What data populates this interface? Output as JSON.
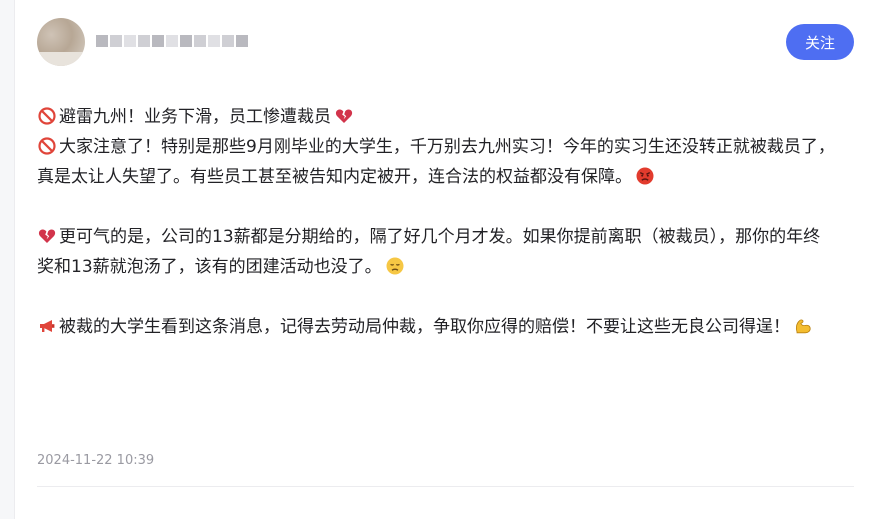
{
  "author": {
    "name": "██████████"
  },
  "follow_button": {
    "label": "关注"
  },
  "post": {
    "line1": "避雷九州！业务下滑，员工惨遭裁员",
    "para1": "大家注意了！特别是那些9月刚毕业的大学生，千万别去九州实习！今年的实习生还没转正就被裁员了，真是太让人失望了。有些员工甚至被告知内定被开，连合法的权益都没有保障。",
    "para2": "更可气的是，公司的13薪都是分期给的，隔了好几个月才发。如果你提前离职（被裁员），那你的年终奖和13薪就泡汤了，该有的团建活动也没了。",
    "para3": "被裁的大学生看到这条消息，记得去劳动局仲裁，争取你应得的赔偿！不要让这些无良公司得逞！"
  },
  "icons": {
    "prohibited": "no-entry-icon",
    "broken_heart": "broken-heart-icon",
    "angry": "angry-face-icon",
    "disappointed": "disappointed-face-icon",
    "megaphone": "megaphone-icon",
    "flexed_biceps": "flexed-biceps-icon"
  },
  "timestamp": "2024-11-22 10:39",
  "colors": {
    "accent": "#4e6ef2",
    "text": "#222226",
    "muted": "#9a9aa2"
  }
}
